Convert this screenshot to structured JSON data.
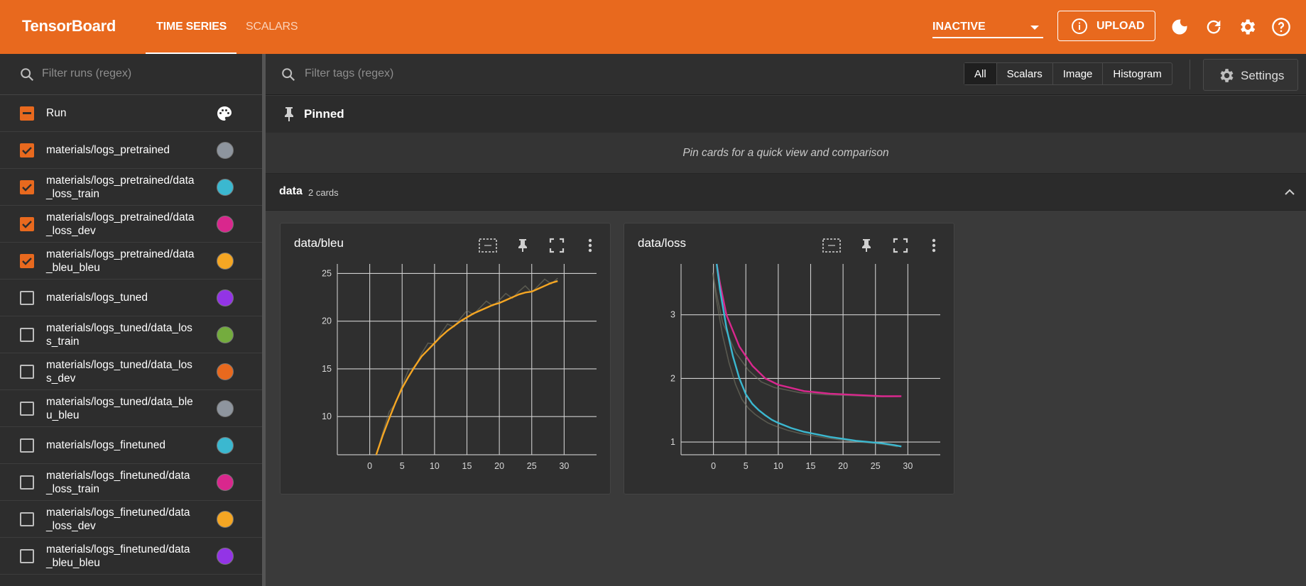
{
  "header": {
    "brand": "TensorBoard",
    "tabs": [
      {
        "label": "TIME SERIES",
        "active": true
      },
      {
        "label": "SCALARS",
        "active": false
      }
    ],
    "status_select": "INACTIVE",
    "upload_label": "UPLOAD",
    "icons": [
      "theme-moon-icon",
      "refresh-icon",
      "gear-icon",
      "help-icon"
    ],
    "accent_color": "#e8691e"
  },
  "sidebar": {
    "filter_placeholder": "Filter runs (regex)",
    "header_label": "Run",
    "runs": [
      {
        "name": "materials/logs_pretrained",
        "checked": true,
        "color": "#8e959e"
      },
      {
        "name": "materials/logs_pretrained/data\n_loss_train",
        "checked": true,
        "color": "#3bb8d0"
      },
      {
        "name": "materials/logs_pretrained/data\n_loss_dev",
        "checked": true,
        "color": "#d9278d"
      },
      {
        "name": "materials/logs_pretrained/data\n_bleu_bleu",
        "checked": true,
        "color": "#f5a623"
      },
      {
        "name": "materials/logs_tuned",
        "checked": false,
        "color": "#9334e6"
      },
      {
        "name": "materials/logs_tuned/data_los\ns_train",
        "checked": false,
        "color": "#74ac3e"
      },
      {
        "name": "materials/logs_tuned/data_los\ns_dev",
        "checked": false,
        "color": "#e8691e"
      },
      {
        "name": "materials/logs_tuned/data_ble\nu_bleu",
        "checked": false,
        "color": "#8e959e"
      },
      {
        "name": "materials/logs_finetuned",
        "checked": false,
        "color": "#3bb8d0"
      },
      {
        "name": "materials/logs_finetuned/data\n_loss_train",
        "checked": false,
        "color": "#d9278d"
      },
      {
        "name": "materials/logs_finetuned/data\n_loss_dev",
        "checked": false,
        "color": "#f5a623"
      },
      {
        "name": "materials/logs_finetuned/data\n_bleu_bleu",
        "checked": false,
        "color": "#9334e6"
      }
    ]
  },
  "main": {
    "filter_placeholder": "Filter tags (regex)",
    "type_filters": [
      {
        "label": "All",
        "selected": true
      },
      {
        "label": "Scalars",
        "selected": false
      },
      {
        "label": "Image",
        "selected": false
      },
      {
        "label": "Histogram",
        "selected": false
      }
    ],
    "settings_label": "Settings",
    "pinned_label": "Pinned",
    "pinned_message": "Pin cards for a quick view and comparison",
    "group": {
      "name": "data",
      "count_label": "2 cards"
    }
  },
  "chart_data": [
    {
      "type": "line",
      "title": "data/bleu",
      "x_ticks": [
        0,
        5,
        10,
        15,
        20,
        25,
        30
      ],
      "y_ticks": [
        10,
        15,
        20,
        25
      ],
      "xlim": [
        -5,
        35
      ],
      "ylim": [
        6,
        26
      ],
      "series": [
        {
          "color": "#f5a623",
          "x": [
            1,
            2,
            3,
            4,
            5,
            6,
            7,
            8,
            9,
            10,
            11,
            12,
            13,
            14,
            15,
            16,
            17,
            18,
            19,
            20,
            21,
            22,
            23,
            24,
            25,
            26,
            27,
            28,
            29
          ],
          "y": [
            6,
            8,
            9.8,
            11.5,
            13,
            14.2,
            15.3,
            16.3,
            17,
            17.7,
            18.4,
            19,
            19.5,
            20,
            20.4,
            20.8,
            21.1,
            21.4,
            21.7,
            21.9,
            22.2,
            22.5,
            22.8,
            23,
            23.1,
            23.4,
            23.7,
            24,
            24.2
          ]
        }
      ]
    },
    {
      "type": "line",
      "title": "data/loss",
      "x_ticks": [
        0,
        5,
        10,
        15,
        20,
        25,
        30
      ],
      "y_ticks": [
        1,
        2,
        3
      ],
      "xlim": [
        -5,
        35
      ],
      "ylim": [
        0.8,
        3.8
      ],
      "series": [
        {
          "color": "#d9278d",
          "x": [
            0.5,
            1,
            2,
            3,
            4,
            5,
            6,
            7,
            8,
            9,
            10,
            12,
            14,
            16,
            18,
            20,
            22,
            24,
            26,
            28,
            29
          ],
          "y": [
            3.8,
            3.5,
            3.0,
            2.75,
            2.5,
            2.35,
            2.2,
            2.1,
            2.0,
            1.95,
            1.9,
            1.85,
            1.8,
            1.78,
            1.76,
            1.75,
            1.74,
            1.73,
            1.72,
            1.72,
            1.72
          ]
        },
        {
          "color": "#3bb8d0",
          "x": [
            0.5,
            1,
            2,
            3,
            4,
            5,
            6,
            7,
            8,
            9,
            10,
            12,
            14,
            16,
            18,
            20,
            22,
            24,
            26,
            28,
            29
          ],
          "y": [
            3.8,
            3.4,
            2.8,
            2.35,
            2.0,
            1.75,
            1.6,
            1.5,
            1.42,
            1.35,
            1.3,
            1.22,
            1.16,
            1.12,
            1.08,
            1.05,
            1.02,
            1.0,
            0.98,
            0.95,
            0.93
          ]
        }
      ]
    }
  ]
}
